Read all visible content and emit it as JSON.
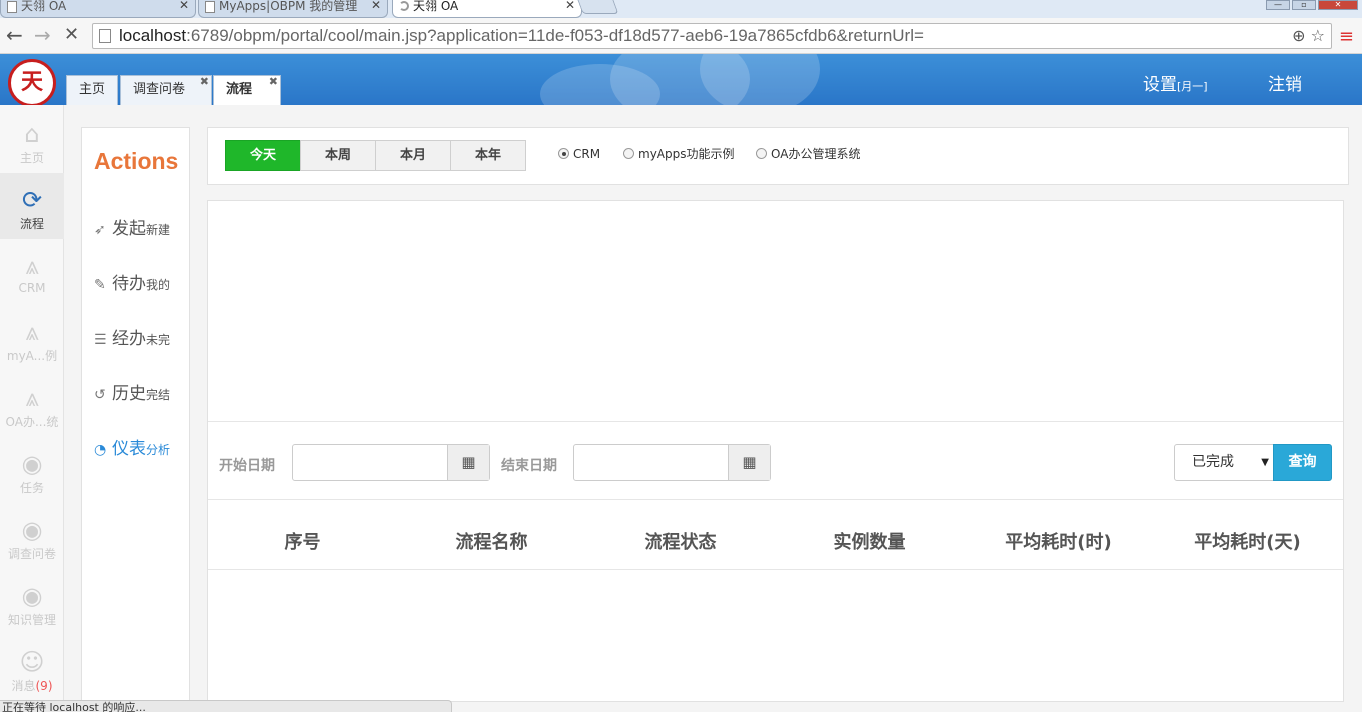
{
  "browser": {
    "tabs": [
      {
        "title": "天翎 OA"
      },
      {
        "title": "MyApps|OBPM 我的管理"
      },
      {
        "title": "天翎 OA"
      }
    ],
    "url_host": "localhost",
    "url_rest": ":6789/obpm/portal/cool/main.jsp?application=11de-f053-df18d577-aeb6-19a7865cfdb6&returnUrl=",
    "status_text": "正在等待 localhost 的响应..."
  },
  "header": {
    "logo_text": "天翎",
    "tabs": [
      {
        "label": "主页"
      },
      {
        "label": "调查问卷"
      },
      {
        "label": "流程"
      }
    ],
    "settings_label": "设置",
    "settings_sub": "[月一]",
    "logout_label": "注销"
  },
  "rail": {
    "items": [
      {
        "label": "主页",
        "icon": "home-icon"
      },
      {
        "label": "流程",
        "icon": "workflow-icon"
      },
      {
        "label": "CRM",
        "icon": "app-icon"
      },
      {
        "label": "myA...例",
        "icon": "app-icon"
      },
      {
        "label": "OA办...统",
        "icon": "app-icon"
      },
      {
        "label": "任务",
        "icon": "task-icon"
      },
      {
        "label": "调查问卷",
        "icon": "survey-icon"
      },
      {
        "label": "知识管理",
        "icon": "knowledge-icon"
      },
      {
        "label": "消息",
        "badge": "(9)",
        "icon": "message-icon"
      }
    ]
  },
  "actions": {
    "title": "Actions",
    "items": [
      {
        "label": "发起",
        "sub": "新建",
        "icon": "rocket-icon"
      },
      {
        "label": "待办",
        "sub": "我的",
        "icon": "edit-icon"
      },
      {
        "label": "经办",
        "sub": "未完",
        "icon": "list-icon"
      },
      {
        "label": "历史",
        "sub": "完结",
        "icon": "history-icon"
      },
      {
        "label": "仪表",
        "sub": "分析",
        "icon": "pie-chart-icon"
      }
    ]
  },
  "filter": {
    "periods": [
      {
        "label": "今天"
      },
      {
        "label": "本周"
      },
      {
        "label": "本月"
      },
      {
        "label": "本年"
      }
    ],
    "apps": [
      {
        "label": "CRM",
        "checked": true
      },
      {
        "label": "myApps功能示例",
        "checked": false
      },
      {
        "label": "OA办公管理系统",
        "checked": false
      }
    ]
  },
  "query": {
    "start_label": "开始日期",
    "start_value": "",
    "end_label": "结束日期",
    "end_value": "",
    "status_selected": "已完成",
    "search_label": "查询"
  },
  "table": {
    "columns": [
      "序号",
      "流程名称",
      "流程状态",
      "实例数量",
      "平均耗时(时)",
      "平均耗时(天)"
    ],
    "rows": []
  },
  "colors": {
    "accent_green": "#1fb72a",
    "accent_blue": "#2aa8d8",
    "actions_orange": "#e8763a",
    "header_blue": "#2a76c8"
  }
}
